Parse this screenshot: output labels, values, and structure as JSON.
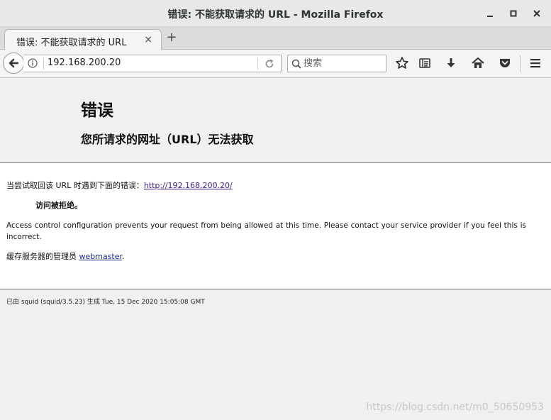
{
  "window": {
    "title": "错误: 不能获取请求的  URL - Mozilla Firefox",
    "minimize_label": "—",
    "maximize_label": "■",
    "close_label": "✕"
  },
  "tabs": [
    {
      "label": "错误: 不能获取请求的 URL",
      "close_label": "×"
    }
  ],
  "new_tab_label": "+",
  "navbar": {
    "url": "192.168.200.20",
    "search_placeholder": "搜索"
  },
  "toolbar_icons": [
    "star-icon",
    "reading-list-icon",
    "download-icon",
    "home-icon",
    "pocket-icon",
    "menu-icon"
  ],
  "page": {
    "title": "错误",
    "subtitle": "您所请求的网址（URL）无法获取",
    "attempt_text": "当尝试取回该 URL 时遇到下面的错误：",
    "attempt_link": "http://192.168.200.20/",
    "denied": "访问被拒绝。",
    "description": "Access control configuration prevents your request from being allowed at this time. Please contact your service provider if you feel this is incorrect.",
    "admin_text": "缓存服务器的管理员 ",
    "admin_link": "webmaster",
    "admin_suffix": ".",
    "footer": "已由 squid (squid/3.5.23) 生成 Tue, 15 Dec 2020 15:05:08 GMT"
  },
  "watermark": "https://blog.csdn.net/m0_50650953",
  "colors": {
    "link": "#3a1a8a",
    "header_bg": "#f0f0f0",
    "body_bg": "#ffffff"
  }
}
